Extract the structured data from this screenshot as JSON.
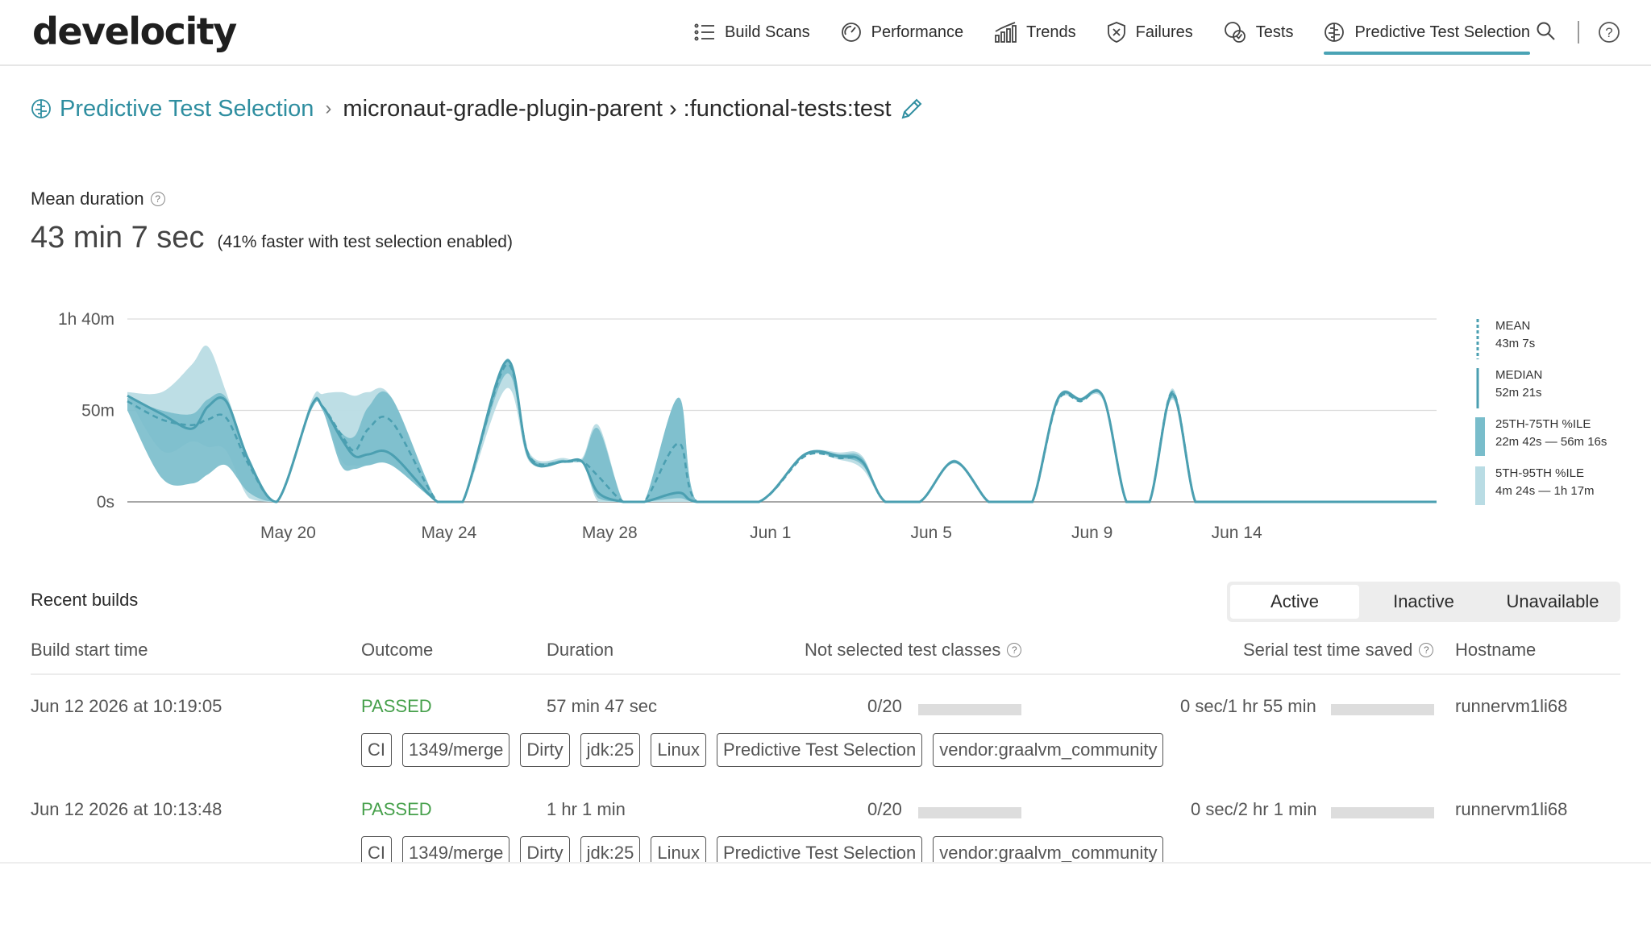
{
  "app": {
    "logo_text": "develocity"
  },
  "nav": {
    "items": [
      {
        "label": "Build Scans",
        "icon": "list-icon"
      },
      {
        "label": "Performance",
        "icon": "gauge-icon"
      },
      {
        "label": "Trends",
        "icon": "bar-trend-icon"
      },
      {
        "label": "Failures",
        "icon": "shield-x-icon"
      },
      {
        "label": "Tests",
        "icon": "tests-icon"
      },
      {
        "label": "Predictive Test Selection",
        "icon": "brain-icon",
        "active": true
      }
    ],
    "search_icon": "search-icon",
    "help_icon": "help-icon"
  },
  "breadcrumb": {
    "root": "Predictive Test Selection",
    "sep": "›",
    "project": "micronaut-gradle-plugin-parent",
    "task": "› :functional-tests:test"
  },
  "summary": {
    "label": "Mean duration",
    "value": "43 min 7 sec",
    "note": "(41% faster with test selection enabled)"
  },
  "chart_data": {
    "type": "area",
    "y_ticks": [
      "0s",
      "50m",
      "1h 40m"
    ],
    "ylim_minutes": [
      0,
      100
    ],
    "x_ticks": [
      "May 20",
      "May 24",
      "May 28",
      "Jun 1",
      "Jun 5",
      "Jun 9",
      "Jun 14"
    ],
    "grid": true,
    "legend_placement": "right",
    "colors": {
      "mean": "#4b9fb1",
      "median": "#4b9fb1",
      "p25_75": "#79bdcb",
      "p5_95": "#b9dce4"
    },
    "x_day": [
      0,
      1.5,
      2.8,
      3.5,
      4.3,
      5.3,
      6.5,
      8,
      8.5,
      9.3,
      9.9,
      10.5,
      11.5,
      13.5,
      14.6,
      16.5,
      17.5,
      19,
      19.8,
      20.5,
      21.6,
      22.5,
      24,
      24.8,
      27.5,
      29.5,
      31,
      32,
      33,
      34.5,
      36,
      37.5,
      38.5,
      39.4,
      40.5,
      41.5,
      42.5,
      43.5,
      44.5,
      45.5,
      46.5,
      47.5,
      48.5,
      50.5,
      52,
      53,
      54,
      55,
      56,
      57
    ],
    "series": [
      {
        "name": "Mean",
        "values": [
          55,
          45,
          42,
          45,
          46,
          20,
          0,
          52,
          52,
          37,
          28,
          40,
          44,
          0,
          0,
          75,
          25,
          22,
          22,
          14,
          0,
          0,
          32,
          0,
          0,
          25,
          24,
          22,
          0,
          0,
          22,
          0,
          0,
          0,
          55,
          55,
          57,
          0,
          0,
          60,
          0,
          0,
          0,
          0,
          0,
          0,
          0,
          0,
          0,
          0
        ]
      },
      {
        "name": "Median",
        "values": [
          58,
          48,
          40,
          52,
          55,
          22,
          0,
          52,
          52,
          35,
          25,
          26,
          26,
          0,
          0,
          77,
          24,
          22,
          22,
          5,
          0,
          0,
          5,
          0,
          0,
          26,
          25,
          22,
          0,
          0,
          22,
          0,
          0,
          0,
          56,
          56,
          57,
          0,
          0,
          59,
          0,
          0,
          0,
          0,
          0,
          0,
          0,
          0,
          0,
          0
        ]
      },
      {
        "name": "25th percentile",
        "values": [
          50,
          13,
          10,
          15,
          20,
          5,
          0,
          50,
          50,
          20,
          18,
          20,
          20,
          0,
          0,
          70,
          23,
          22,
          22,
          2,
          0,
          0,
          2,
          0,
          0,
          25,
          24,
          20,
          0,
          0,
          22,
          0,
          0,
          0,
          55,
          55,
          56,
          0,
          0,
          57,
          0,
          0,
          0,
          0,
          0,
          0,
          0,
          0,
          0,
          0
        ]
      },
      {
        "name": "75th percentile",
        "values": [
          57,
          50,
          48,
          56,
          57,
          24,
          0,
          53,
          53,
          38,
          36,
          52,
          57,
          0,
          0,
          78,
          26,
          23,
          23,
          40,
          0,
          0,
          57,
          0,
          0,
          26,
          26,
          24,
          0,
          0,
          23,
          0,
          0,
          0,
          56,
          56,
          57,
          0,
          0,
          61,
          0,
          0,
          0,
          0,
          0,
          0,
          0,
          0,
          0,
          0
        ]
      },
      {
        "name": "5th percentile",
        "values": [
          58,
          28,
          33,
          30,
          28,
          2,
          0,
          50,
          50,
          23,
          20,
          20,
          20,
          0,
          0,
          62,
          22,
          22,
          22,
          0,
          0,
          0,
          0,
          0,
          0,
          25,
          23,
          18,
          0,
          0,
          21,
          0,
          0,
          0,
          54,
          55,
          55,
          0,
          0,
          56,
          0,
          0,
          0,
          0,
          0,
          0,
          0,
          0,
          0,
          0
        ]
      },
      {
        "name": "95th percentile",
        "values": [
          60,
          60,
          75,
          85,
          60,
          24,
          0,
          55,
          59,
          60,
          58,
          60,
          57,
          0,
          0,
          78,
          27,
          24,
          24,
          42,
          0,
          0,
          57,
          0,
          0,
          26,
          27,
          25,
          0,
          0,
          23,
          0,
          0,
          0,
          57,
          57,
          58,
          0,
          0,
          62,
          0,
          0,
          0,
          0,
          0,
          0,
          0,
          0,
          0,
          0
        ]
      }
    ]
  },
  "legend": [
    {
      "name": "MEAN",
      "value": "43m 7s",
      "kind": "dashed"
    },
    {
      "name": "MEDIAN",
      "value": "52m 21s",
      "kind": "solid"
    },
    {
      "name": "25TH-75TH %ILE",
      "value": "22m 42s — 56m 16s",
      "kind": "p25"
    },
    {
      "name": "5TH-95TH %ILE",
      "value": "4m 24s — 1h 17m",
      "kind": "p5"
    }
  ],
  "recent": {
    "title": "Recent builds",
    "filters": [
      {
        "label": "Active",
        "active": true
      },
      {
        "label": "Inactive",
        "active": false
      },
      {
        "label": "Unavailable",
        "active": false
      }
    ],
    "columns": {
      "start": "Build start time",
      "outcome": "Outcome",
      "duration": "Duration",
      "not_selected": "Not selected test classes",
      "saved": "Serial test time saved",
      "host": "Hostname"
    },
    "rows": [
      {
        "start": "Jun 12 2026 at 10:19:05",
        "outcome": "PASSED",
        "duration": "57 min 47 sec",
        "not_selected": "0/20",
        "not_selected_fraction": 0,
        "saved": "0 sec/1 hr 55 min",
        "saved_fraction": 0,
        "host": "runnervm1li68",
        "tags": [
          "CI",
          "1349/merge",
          "Dirty",
          "jdk:25",
          "Linux",
          "Predictive Test Selection",
          "vendor:graalvm_community"
        ]
      },
      {
        "start": "Jun 12 2026 at 10:13:48",
        "outcome": "PASSED",
        "duration": "1 hr 1 min",
        "not_selected": "0/20",
        "not_selected_fraction": 0,
        "saved": "0 sec/2 hr 1 min",
        "saved_fraction": 0,
        "host": "runnervm1li68",
        "tags": [
          "CI",
          "1349/merge",
          "Dirty",
          "jdk:25",
          "Linux",
          "Predictive Test Selection",
          "vendor:graalvm_community"
        ]
      }
    ]
  }
}
